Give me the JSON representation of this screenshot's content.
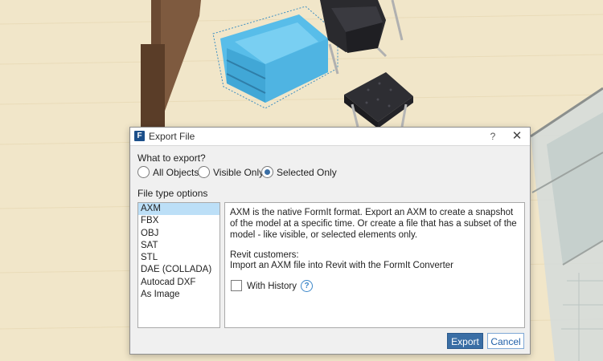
{
  "dialog": {
    "title": "Export File",
    "app_icon_letter": "F",
    "help_label": "?",
    "close_label": "✕"
  },
  "what_to_export": {
    "label": "What to export?",
    "options": [
      {
        "label": "All Objects",
        "checked": false
      },
      {
        "label": "Visible Only",
        "checked": false
      },
      {
        "label": "Selected Only",
        "checked": true
      }
    ]
  },
  "file_type": {
    "label": "File type options",
    "items": [
      "AXM",
      "FBX",
      "OBJ",
      "SAT",
      "STL",
      "DAE (COLLADA)",
      "Autocad DXF",
      "As Image"
    ],
    "selected": "AXM"
  },
  "description": {
    "text": "AXM is the native FormIt format. Export an AXM to create a snapshot of the model at a specific time. Or create a file that has a subset of the model - like visible, or selected elements only.",
    "revit_heading": "Revit customers:",
    "revit_text": "Import an AXM file into Revit with the FormIt Converter",
    "with_history_label": "With History",
    "with_history_checked": false,
    "info_icon": "?"
  },
  "buttons": {
    "export": "Export",
    "cancel": "Cancel"
  },
  "colors": {
    "selection_highlight": "#60c8f4",
    "primary_button": "#3a6ea5",
    "list_selected": "#bcdff7"
  }
}
